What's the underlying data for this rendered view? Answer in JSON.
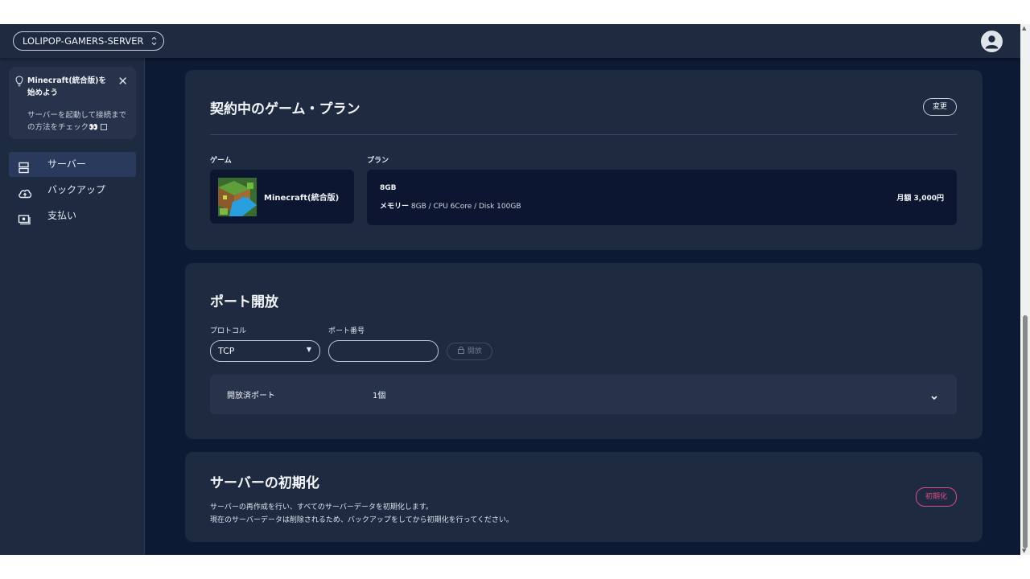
{
  "header": {
    "server_name": "LOLIPOP-GAMERS-SERVER",
    "server_icon": "updown-arrow-icon",
    "user_icon": "user-avatar-icon"
  },
  "sidebar": {
    "guide": {
      "title": "Minecraft(統合版)を始めよう",
      "text": "サーバーを起動して接続までの方法をチェック",
      "emoji": "👀"
    },
    "items": [
      {
        "label": "サーバー",
        "icon": "server-icon",
        "active": true
      },
      {
        "label": "バックアップ",
        "icon": "cloud-upload-icon",
        "active": false
      },
      {
        "label": "支払い",
        "icon": "payment-icon",
        "active": false
      }
    ]
  },
  "plan": {
    "title": "契約中のゲーム・プラン",
    "change_label": "変更",
    "game_label": "ゲーム",
    "plan_label": "プラン",
    "game_name": "Minecraft(統合版)",
    "plan_name": "8GB",
    "spec_prefix": "メモリー",
    "spec": "8GB / CPU 6Core / Disk 100GB",
    "price": "月額 3,000円"
  },
  "port": {
    "title": "ポート開放",
    "protocol_label": "プロトコル",
    "port_label": "ポート番号",
    "protocol_value": "TCP",
    "port_value": "",
    "open_label": "開放",
    "opened_label": "開放済ポート",
    "opened_count": "1個"
  },
  "reset": {
    "title": "サーバーの初期化",
    "desc1": "サーバーの再作成を行い、すべてのサーバーデータを初期化します。",
    "desc2": "現在のサーバーデータは削除されるため、バックアップをしてから初期化を行ってください。",
    "button": "初期化"
  },
  "colors": {
    "background": "#0d1a33",
    "card": "#1e2a40",
    "panel": "#0c1630",
    "danger": "#e04d86"
  }
}
